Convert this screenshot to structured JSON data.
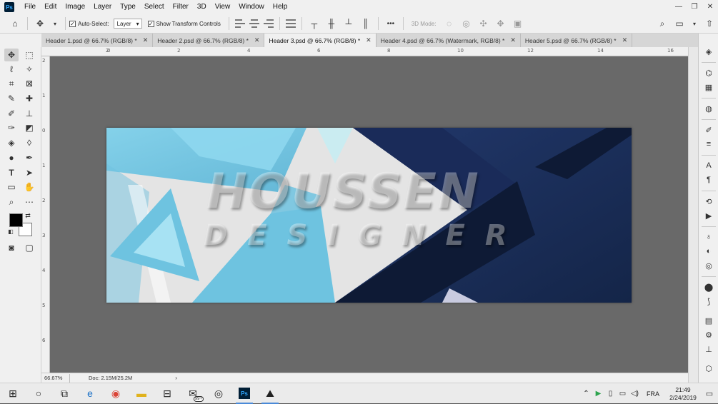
{
  "menubar": {
    "logo": "Ps",
    "items": [
      "File",
      "Edit",
      "Image",
      "Layer",
      "Type",
      "Select",
      "Filter",
      "3D",
      "View",
      "Window",
      "Help"
    ],
    "window_controls": [
      "—",
      "❐",
      "✕"
    ]
  },
  "options": {
    "auto_select_label": "Auto-Select:",
    "auto_select_checked": true,
    "auto_select_target": "Layer",
    "show_transform_label": "Show Transform Controls",
    "show_transform_checked": true,
    "mode_3d_label": "3D Mode:",
    "more_label": "•••"
  },
  "tabs": [
    {
      "label": "Header 1.psd @ 66.7% (RGB/8) *",
      "active": false
    },
    {
      "label": "Header 2.psd @ 66.7% (RGB/8) *",
      "active": false
    },
    {
      "label": "Header 3.psd @ 66.7% (RGB/8) *",
      "active": true
    },
    {
      "label": "Header 4.psd @ 66.7% (Watermark, RGB/8) *",
      "active": false
    },
    {
      "label": "Header 5.psd @ 66.7% (RGB/8) *",
      "active": false
    }
  ],
  "tab_close": "✕",
  "ruler_top": [
    "2",
    "0",
    "2",
    "4",
    "6",
    "8",
    "10",
    "12",
    "14",
    "16"
  ],
  "ruler_left": [
    "2",
    "1",
    "0",
    "1",
    "2",
    "3",
    "4",
    "5",
    "6"
  ],
  "canvas": {
    "watermark_line1": "HOUSSEN",
    "watermark_line2": "DESIGNER",
    "colors": {
      "light_blue": "#6ec3e0",
      "dark_navy": "#1d2f5e",
      "deep_navy": "#0e1a35",
      "light_gray": "#e6e6e6",
      "pasteboard": "#696969"
    }
  },
  "status": {
    "zoom": "66.67%",
    "doc_info": "Doc: 2.15M/25.2M",
    "arrow": "›"
  },
  "taskbar": {
    "items": [
      "windows-start",
      "cortana",
      "task-view",
      "edge",
      "chrome",
      "file-explorer",
      "store",
      "mail",
      "obs",
      "photoshop",
      "photos"
    ],
    "badge": "99+",
    "lang": "FRA",
    "time": "21:49",
    "date": "2/24/2019"
  }
}
